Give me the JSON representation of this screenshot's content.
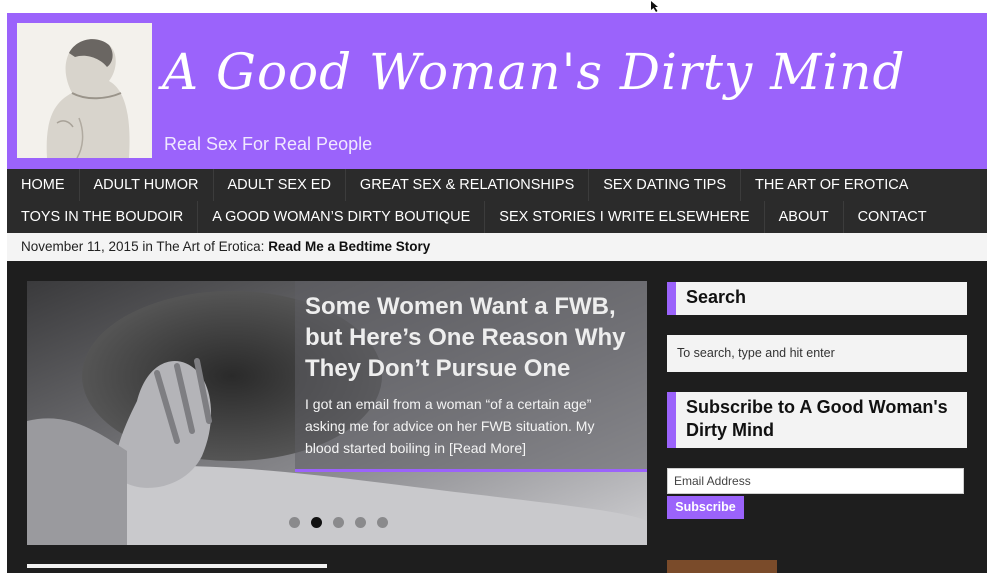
{
  "header": {
    "site_title": "A Good Woman's Dirty Mind",
    "tagline": "Real Sex For Real People"
  },
  "nav": {
    "row1": [
      "HOME",
      "ADULT HUMOR",
      "ADULT SEX ED",
      "GREAT SEX & RELATIONSHIPS",
      "SEX DATING TIPS",
      "THE ART OF EROTICA"
    ],
    "row2": [
      "TOYS IN THE BOUDOIR",
      "A GOOD WOMAN’S DIRTY BOUTIQUE",
      "SEX STORIES I WRITE ELSEWHERE",
      "ABOUT",
      "CONTACT"
    ]
  },
  "ticker": {
    "date": "November 11, 2015",
    "in": "in",
    "category": "The Art of Erotica:",
    "post_title": "Read Me a Bedtime Story"
  },
  "slider": {
    "title": "Some Women Want a FWB, but Here’s One Reason Why They Don’t Pursue One",
    "excerpt": "I got an email from a woman “of a certain age” asking me for advice on her FWB situation. My blood started boiling in [Read More]",
    "dots": 5,
    "active_dot": 2
  },
  "sidebar": {
    "search_title": "Search",
    "search_placeholder": "To search, type and hit enter",
    "subscribe_title": "Subscribe to A Good Woman's Dirty Mind",
    "email_placeholder": "Email Address",
    "subscribe_button": "Subscribe"
  },
  "colors": {
    "accent": "#9b63fb",
    "nav_bg": "#2b2b2b",
    "body_bg": "#1e1e1e"
  }
}
